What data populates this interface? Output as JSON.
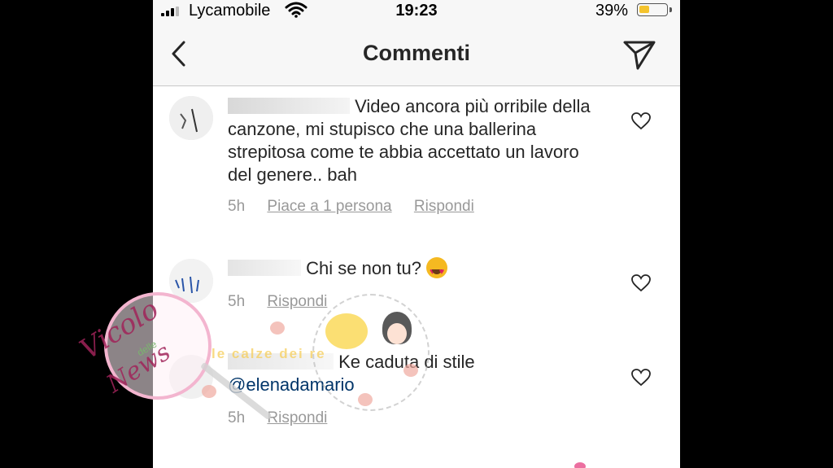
{
  "status_bar": {
    "carrier": "Lycamobile",
    "time": "19:23",
    "battery_percent": "39%",
    "battery_level": 0.39,
    "battery_color": "#f4c32d"
  },
  "header": {
    "title": "Commenti",
    "back_icon": "chevron-left-icon",
    "share_icon": "paper-plane-icon"
  },
  "comments": [
    {
      "username": "",
      "text": "Video ancora più orribile della canzone, mi stupisco che una ballerina strepitosa come te abbia accettato un lavoro del genere.. bah",
      "time": "5h",
      "likes": "Piace a 1 persona",
      "reply": "Rispondi"
    },
    {
      "username": "",
      "text": "Chi se non tu?",
      "time": "5h",
      "reply": "Rispondi"
    },
    {
      "username": "",
      "text": "Ke caduta di stile",
      "mention": "@elenadamario",
      "time": "5h",
      "reply": "Rispondi"
    }
  ],
  "watermark": {
    "script_line1": "Vicolo",
    "script_small": "delle",
    "script_line2": "News",
    "band_text": "le calze dei re"
  },
  "colors": {
    "text": "#262626",
    "meta": "#999999",
    "mention": "#003569",
    "header_bg": "#f7f7f7"
  }
}
